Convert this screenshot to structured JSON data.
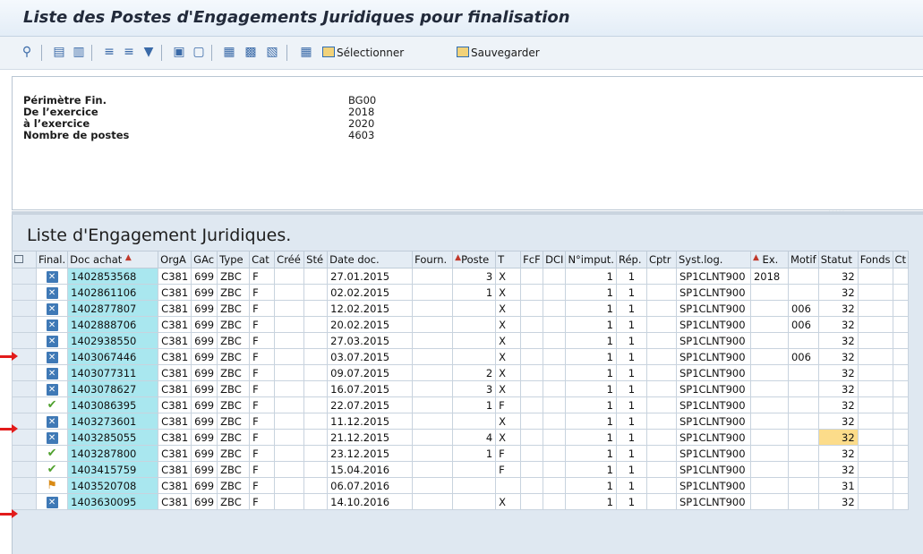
{
  "title": "Liste des Postes d'Engagements Juridiques pour finalisation",
  "toolbar": {
    "icons": [
      "find-icon",
      "details-icon",
      "print-icon",
      "sort-ascending-icon",
      "sort-descending-icon",
      "filter-icon",
      "sum-icon",
      "subtotal-icon",
      "export-icon",
      "mail-icon",
      "graphic-icon",
      "layout-icon"
    ],
    "select_label": "Sélectionner",
    "save_label": "Sauvegarder"
  },
  "header": {
    "labels": [
      "Périmètre Fin.",
      "De l’exercice",
      "à l’exercice",
      "Nombre de postes"
    ],
    "values": [
      "BG00",
      "2018",
      "2020",
      "4603"
    ]
  },
  "list": {
    "title": "Liste d'Engagement Juridiques.",
    "columns": [
      "Final.",
      "Doc achat",
      "OrgA",
      "GAc",
      "Type",
      "Cat",
      "Créé",
      "Sté",
      "Date doc.",
      "Fourn.",
      "Poste",
      "T",
      "FcF",
      "DCI",
      "N°imput.",
      "Rép.",
      "Cptr",
      "Syst.log.",
      "Ex.",
      "Motif",
      "Statut",
      "Fonds",
      "Ct"
    ],
    "rows": [
      {
        "final": "x",
        "doc": "1402853568",
        "orga": "C381",
        "gac": "699",
        "type": "ZBC",
        "cat": "F",
        "date": "27.01.2015",
        "poste": "3",
        "t": "X",
        "imput": "1",
        "rep": "1",
        "syst": "SP1CLNT900",
        "ex": "2018",
        "motif": "",
        "statut": "32"
      },
      {
        "final": "x",
        "doc": "1402861106",
        "orga": "C381",
        "gac": "699",
        "type": "ZBC",
        "cat": "F",
        "date": "02.02.2015",
        "poste": "1",
        "t": "X",
        "imput": "1",
        "rep": "1",
        "syst": "SP1CLNT900",
        "ex": "",
        "motif": "",
        "statut": "32"
      },
      {
        "final": "x",
        "doc": "1402877807",
        "orga": "C381",
        "gac": "699",
        "type": "ZBC",
        "cat": "F",
        "date": "12.02.2015",
        "poste": "",
        "t": "X",
        "imput": "1",
        "rep": "1",
        "syst": "SP1CLNT900",
        "ex": "",
        "motif": "006",
        "statut": "32"
      },
      {
        "final": "x",
        "doc": "1402888706",
        "orga": "C381",
        "gac": "699",
        "type": "ZBC",
        "cat": "F",
        "date": "20.02.2015",
        "poste": "",
        "t": "X",
        "imput": "1",
        "rep": "1",
        "syst": "SP1CLNT900",
        "ex": "",
        "motif": "006",
        "statut": "32"
      },
      {
        "final": "x",
        "doc": "1402938550",
        "orga": "C381",
        "gac": "699",
        "type": "ZBC",
        "cat": "F",
        "date": "27.03.2015",
        "poste": "",
        "t": "X",
        "imput": "1",
        "rep": "1",
        "syst": "SP1CLNT900",
        "ex": "",
        "motif": "",
        "statut": "32"
      },
      {
        "final": "x",
        "doc": "1403067446",
        "orga": "C381",
        "gac": "699",
        "type": "ZBC",
        "cat": "F",
        "date": "03.07.2015",
        "poste": "",
        "t": "X",
        "imput": "1",
        "rep": "1",
        "syst": "SP1CLNT900",
        "ex": "",
        "motif": "006",
        "statut": "32"
      },
      {
        "final": "x",
        "doc": "1403077311",
        "orga": "C381",
        "gac": "699",
        "type": "ZBC",
        "cat": "F",
        "date": "09.07.2015",
        "poste": "2",
        "t": "X",
        "imput": "1",
        "rep": "1",
        "syst": "SP1CLNT900",
        "ex": "",
        "motif": "",
        "statut": "32"
      },
      {
        "final": "x",
        "doc": "1403078627",
        "orga": "C381",
        "gac": "699",
        "type": "ZBC",
        "cat": "F",
        "date": "16.07.2015",
        "poste": "3",
        "t": "X",
        "imput": "1",
        "rep": "1",
        "syst": "SP1CLNT900",
        "ex": "",
        "motif": "",
        "statut": "32"
      },
      {
        "final": "ok",
        "doc": "1403086395",
        "orga": "C381",
        "gac": "699",
        "type": "ZBC",
        "cat": "F",
        "date": "22.07.2015",
        "poste": "1",
        "t": "F",
        "imput": "1",
        "rep": "1",
        "syst": "SP1CLNT900",
        "ex": "",
        "motif": "",
        "statut": "32"
      },
      {
        "final": "x",
        "doc": "1403273601",
        "orga": "C381",
        "gac": "699",
        "type": "ZBC",
        "cat": "F",
        "date": "11.12.2015",
        "poste": "",
        "t": "X",
        "imput": "1",
        "rep": "1",
        "syst": "SP1CLNT900",
        "ex": "",
        "motif": "",
        "statut": "32"
      },
      {
        "final": "x",
        "doc": "1403285055",
        "orga": "C381",
        "gac": "699",
        "type": "ZBC",
        "cat": "F",
        "date": "21.12.2015",
        "poste": "4",
        "t": "X",
        "imput": "1",
        "rep": "1",
        "syst": "SP1CLNT900",
        "ex": "",
        "motif": "",
        "statut": "32",
        "highlight": true
      },
      {
        "final": "ok",
        "doc": "1403287800",
        "orga": "C381",
        "gac": "699",
        "type": "ZBC",
        "cat": "F",
        "date": "23.12.2015",
        "poste": "1",
        "t": "F",
        "imput": "1",
        "rep": "1",
        "syst": "SP1CLNT900",
        "ex": "",
        "motif": "",
        "statut": "32"
      },
      {
        "final": "ok",
        "doc": "1403415759",
        "orga": "C381",
        "gac": "699",
        "type": "ZBC",
        "cat": "F",
        "date": "15.04.2016",
        "poste": "",
        "t": "F",
        "imput": "1",
        "rep": "1",
        "syst": "SP1CLNT900",
        "ex": "",
        "motif": "",
        "statut": "32"
      },
      {
        "final": "warn",
        "doc": "1403520708",
        "orga": "C381",
        "gac": "699",
        "type": "ZBC",
        "cat": "F",
        "date": "06.07.2016",
        "poste": "",
        "t": "",
        "imput": "1",
        "rep": "1",
        "syst": "SP1CLNT900",
        "ex": "",
        "motif": "",
        "statut": "31"
      },
      {
        "final": "x",
        "doc": "1403630095",
        "orga": "C381",
        "gac": "699",
        "type": "ZBC",
        "cat": "F",
        "date": "14.10.2016",
        "poste": "",
        "t": "X",
        "imput": "1",
        "rep": "1",
        "syst": "SP1CLNT900",
        "ex": "",
        "motif": "",
        "statut": "32"
      }
    ]
  },
  "colors": {
    "key_column": "#a9e7ef",
    "highlight": "#fcdc8a",
    "arrow": "#e21b1b",
    "status_ok": "#4fa12e",
    "status_x": "#3f79b6"
  }
}
